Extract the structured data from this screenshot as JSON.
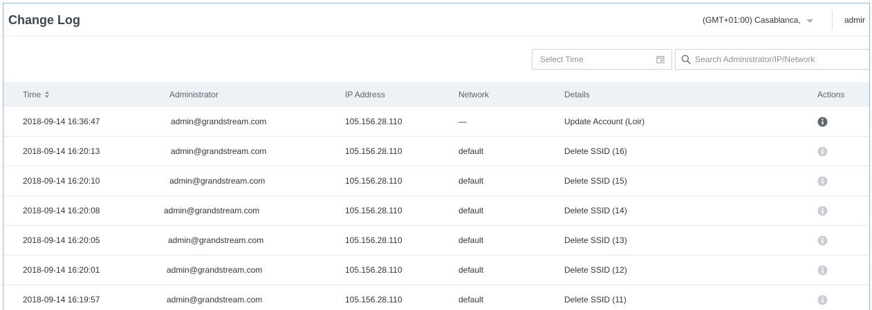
{
  "header": {
    "title": "Change Log",
    "timezone": "(GMT+01:00) Casablanca,",
    "user": "admir"
  },
  "toolbar": {
    "time_placeholder": "Select Time",
    "search_placeholder": "Search Administrator/IP/Network"
  },
  "table": {
    "columns": [
      "Time",
      "Administrator",
      "IP Address",
      "Network",
      "Details",
      "Actions"
    ],
    "rows": [
      {
        "time": "2018-09-14 16:36:47",
        "admin": "admin@grandstream.com",
        "ip": "105.156.28.110",
        "network": "—",
        "details": "Update Account (Loir)",
        "active": true
      },
      {
        "time": "2018-09-14 16:20:13",
        "admin": "admin@grandstream.com",
        "ip": "105.156.28.110",
        "network": "default",
        "details": "Delete SSID (16)",
        "active": false
      },
      {
        "time": "2018-09-14 16:20:10",
        "admin": "admin@grandstream.com",
        "ip": "105.156.28.110",
        "network": "default",
        "details": "Delete SSID (15)",
        "active": false
      },
      {
        "time": "2018-09-14 16:20:08",
        "admin": "admin@grandstream.com",
        "ip": "105.156.28.110",
        "network": "default",
        "details": "Delete SSID (14)",
        "active": false
      },
      {
        "time": "2018-09-14 16:20:05",
        "admin": "admin@grandstream.com",
        "ip": "105.156.28.110",
        "network": "default",
        "details": "Delete SSID (13)",
        "active": false
      },
      {
        "time": "2018-09-14 16:20:01",
        "admin": "admin@grandstream.com",
        "ip": "105.156.28.110",
        "network": "default",
        "details": "Delete SSID (12)",
        "active": false
      },
      {
        "time": "2018-09-14 16:19:57",
        "admin": "admin@grandstream.com",
        "ip": "105.156.28.110",
        "network": "default",
        "details": "Delete SSID (11)",
        "active": false
      }
    ]
  },
  "colors": {
    "info_active": "#5e6670",
    "info_inactive": "#c9ced4",
    "header_bg": "#eef2f7",
    "frame_border": "#8fb4df"
  },
  "icons": {
    "calendar": "calendar-icon",
    "search": "search-icon",
    "sort": "sort-icon",
    "info": "info-icon",
    "dropdown": "chevron-down-icon"
  }
}
